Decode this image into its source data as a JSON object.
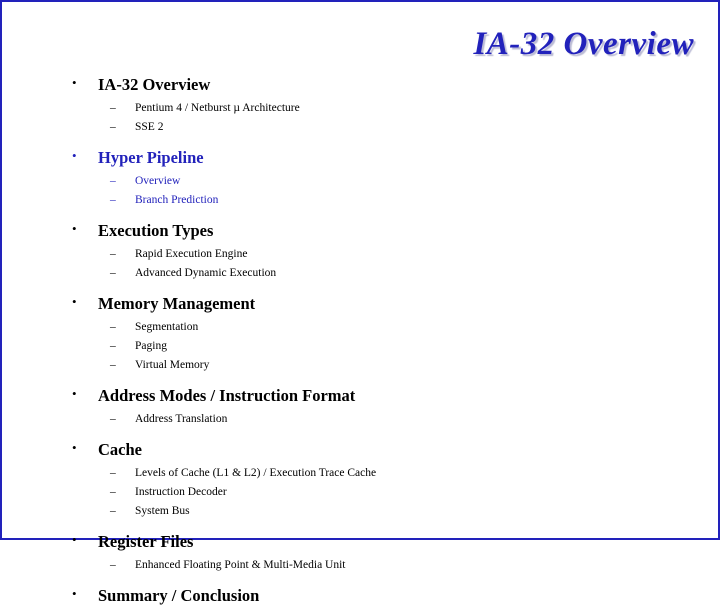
{
  "slide": {
    "title": "IA-32 Overview",
    "bullet_glyph": "•",
    "dash_glyph": "–",
    "accent_color": "#2222bb",
    "border_color": "#2222bb",
    "items": [
      {
        "label": "IA-32 Overview",
        "color": "black",
        "subitems": [
          {
            "label": "Pentium 4 / Netburst µ Architecture",
            "color": "black"
          },
          {
            "label": "SSE 2",
            "color": "black"
          }
        ]
      },
      {
        "label": "Hyper Pipeline",
        "color": "blue",
        "subitems": [
          {
            "label": "Overview",
            "color": "blue"
          },
          {
            "label": "Branch Prediction",
            "color": "blue"
          }
        ]
      },
      {
        "label": "Execution Types",
        "color": "black",
        "subitems": [
          {
            "label": "Rapid Execution Engine",
            "color": "black"
          },
          {
            "label": "Advanced Dynamic Execution",
            "color": "black"
          }
        ]
      },
      {
        "label": "Memory Management",
        "color": "black",
        "subitems": [
          {
            "label": "Segmentation",
            "color": "black"
          },
          {
            "label": "Paging",
            "color": "black"
          },
          {
            "label": "Virtual Memory",
            "color": "black"
          }
        ]
      },
      {
        "label": "Address Modes / Instruction Format",
        "color": "black",
        "subitems": [
          {
            "label": "Address Translation",
            "color": "black"
          }
        ]
      },
      {
        "label": "Cache",
        "color": "black",
        "subitems": [
          {
            "label": "Levels of Cache (L1 & L2) / Execution Trace Cache",
            "color": "black"
          },
          {
            "label": "Instruction Decoder",
            "color": "black"
          },
          {
            "label": "System Bus",
            "color": "black"
          }
        ]
      },
      {
        "label": "Register Files",
        "color": "black",
        "subitems": [
          {
            "label": "Enhanced Floating Point & Multi-Media Unit",
            "color": "black"
          }
        ]
      },
      {
        "label": "Summary / Conclusion",
        "color": "black",
        "subitems": []
      }
    ]
  }
}
